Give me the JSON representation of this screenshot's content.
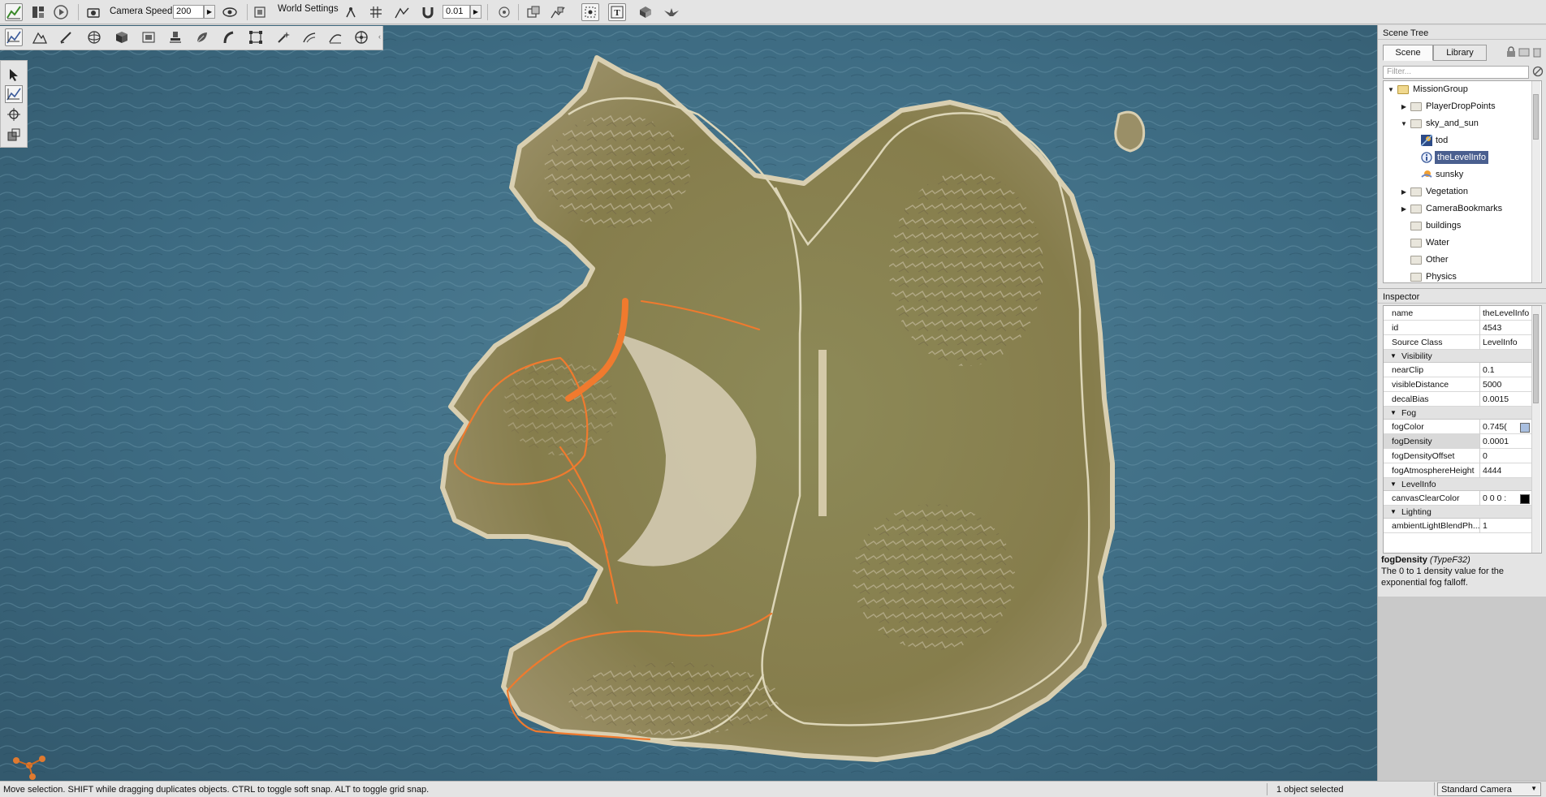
{
  "toolbar": {
    "camera_speed_label": "Camera Speed",
    "camera_speed_value": "200",
    "world_settings_label": "World Settings",
    "snap_value": "0.01"
  },
  "scene_tree": {
    "title": "Scene Tree",
    "tabs": [
      {
        "label": "Scene",
        "selected": true
      },
      {
        "label": "Library",
        "selected": false
      }
    ],
    "filter_placeholder": "Filter...",
    "items": [
      {
        "label": "MissionGroup",
        "level": 0,
        "expanded": true,
        "icon": "folder-open-icon"
      },
      {
        "label": "PlayerDropPoints",
        "level": 1,
        "expandable": true,
        "icon": "folder-icon"
      },
      {
        "label": "sky_and_sun",
        "level": 1,
        "expanded": true,
        "icon": "folder-icon"
      },
      {
        "label": "tod",
        "level": 2,
        "icon": "time-of-day-icon"
      },
      {
        "label": "theLevelInfo",
        "level": 2,
        "icon": "info-icon",
        "selected": true
      },
      {
        "label": "sunsky",
        "level": 2,
        "icon": "sun-sky-icon"
      },
      {
        "label": "Vegetation",
        "level": 1,
        "expandable": true,
        "icon": "folder-icon"
      },
      {
        "label": "CameraBookmarks",
        "level": 1,
        "expandable": true,
        "icon": "folder-icon"
      },
      {
        "label": "buildings",
        "level": 1,
        "icon": "folder-icon"
      },
      {
        "label": "Water",
        "level": 1,
        "icon": "folder-icon"
      },
      {
        "label": "Other",
        "level": 1,
        "icon": "folder-icon"
      },
      {
        "label": "Physics",
        "level": 1,
        "icon": "folder-icon"
      }
    ]
  },
  "inspector": {
    "title": "Inspector",
    "rows": [
      {
        "kind": "prop",
        "key": "name",
        "value": "theLevelInfo"
      },
      {
        "kind": "prop",
        "key": "id",
        "value": "4543"
      },
      {
        "kind": "prop",
        "key": "Source Class",
        "value": "LevelInfo"
      },
      {
        "kind": "group",
        "label": "Visibility"
      },
      {
        "kind": "prop",
        "key": "nearClip",
        "value": "0.1"
      },
      {
        "kind": "prop",
        "key": "visibleDistance",
        "value": "5000"
      },
      {
        "kind": "prop",
        "key": "decalBias",
        "value": "0.0015"
      },
      {
        "kind": "group",
        "label": "Fog"
      },
      {
        "kind": "prop",
        "key": "fogColor",
        "value": "0.745(",
        "swatch": "#a9bfe0"
      },
      {
        "kind": "prop",
        "key": "fogDensity",
        "value": "0.0001",
        "highlight": true
      },
      {
        "kind": "prop",
        "key": "fogDensityOffset",
        "value": "0"
      },
      {
        "kind": "prop",
        "key": "fogAtmosphereHeight",
        "value": "4444"
      },
      {
        "kind": "group",
        "label": "LevelInfo"
      },
      {
        "kind": "prop",
        "key": "canvasClearColor",
        "value": "0 0 0 :",
        "swatch": "#000000"
      },
      {
        "kind": "group",
        "label": "Lighting"
      },
      {
        "kind": "prop",
        "key": "ambientLightBlendPh...",
        "value": "1"
      }
    ],
    "help_field": "fogDensity",
    "help_type": "(TypeF32)",
    "help_text": "The 0 to 1 density value for the exponential fog falloff."
  },
  "status": {
    "message": "Move selection.  SHIFT while dragging duplicates objects.  CTRL to toggle soft snap.  ALT to toggle grid snap.",
    "selection": "1 object selected",
    "camera": "Standard Camera"
  },
  "colors": {
    "water": "#3f6e86",
    "terrain": "#8f8550",
    "road_paths": "#f07a2e",
    "selection": "#4a5f8f"
  }
}
